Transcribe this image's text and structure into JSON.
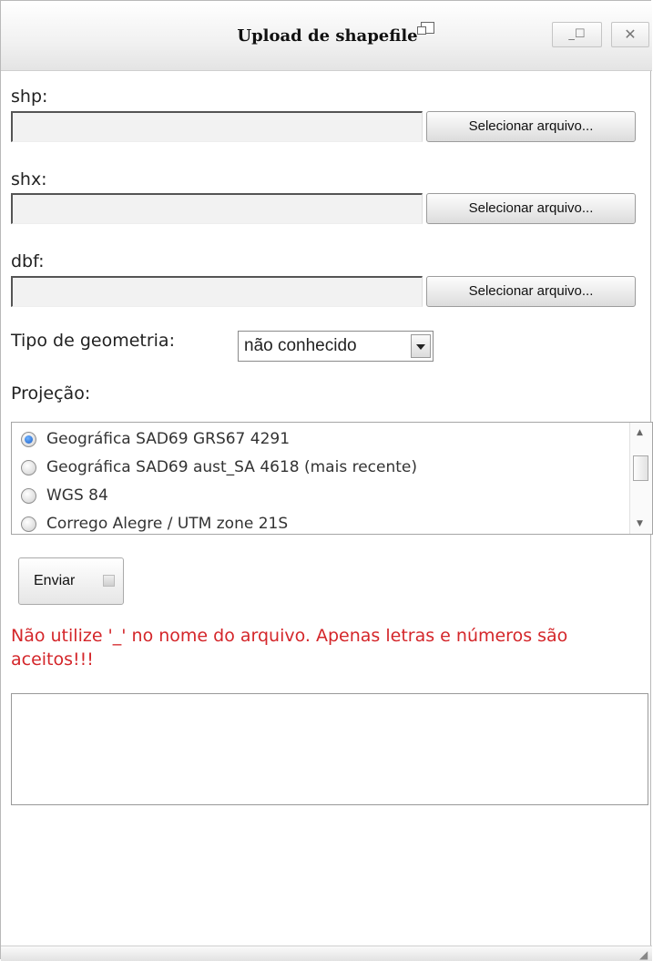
{
  "window": {
    "title": "Upload de shapefile",
    "maximize_glyph": "_☐",
    "close_glyph": "✕"
  },
  "fields": [
    {
      "label": "shp:",
      "value": "",
      "button_label": "Selecionar arquivo..."
    },
    {
      "label": "shx:",
      "value": "",
      "button_label": "Selecionar arquivo..."
    },
    {
      "label": "dbf:",
      "value": "",
      "button_label": "Selecionar arquivo..."
    }
  ],
  "geometry": {
    "label": "Tipo de geometria:",
    "selected": "não conhecido"
  },
  "projection": {
    "label": "Projeção:",
    "options": [
      {
        "label": "Geográfica SAD69 GRS67 4291",
        "checked": true
      },
      {
        "label": "Geográfica SAD69 aust_SA 4618 (mais recente)",
        "checked": false
      },
      {
        "label": "WGS 84",
        "checked": false
      },
      {
        "label": "Corrego Alegre / UTM zone 21S",
        "checked": false
      }
    ]
  },
  "submit": {
    "label": "Enviar"
  },
  "warning": "Não utilize '_' no nome do arquivo. Apenas letras e números são aceitos!!!",
  "output": {
    "value": ""
  },
  "icons": {
    "popout": "popout-icon",
    "dropdown": "chevron-down-icon",
    "send": "send-icon"
  },
  "colors": {
    "warning_text": "#d4262a",
    "radio_selected": "#1d5fc6"
  }
}
